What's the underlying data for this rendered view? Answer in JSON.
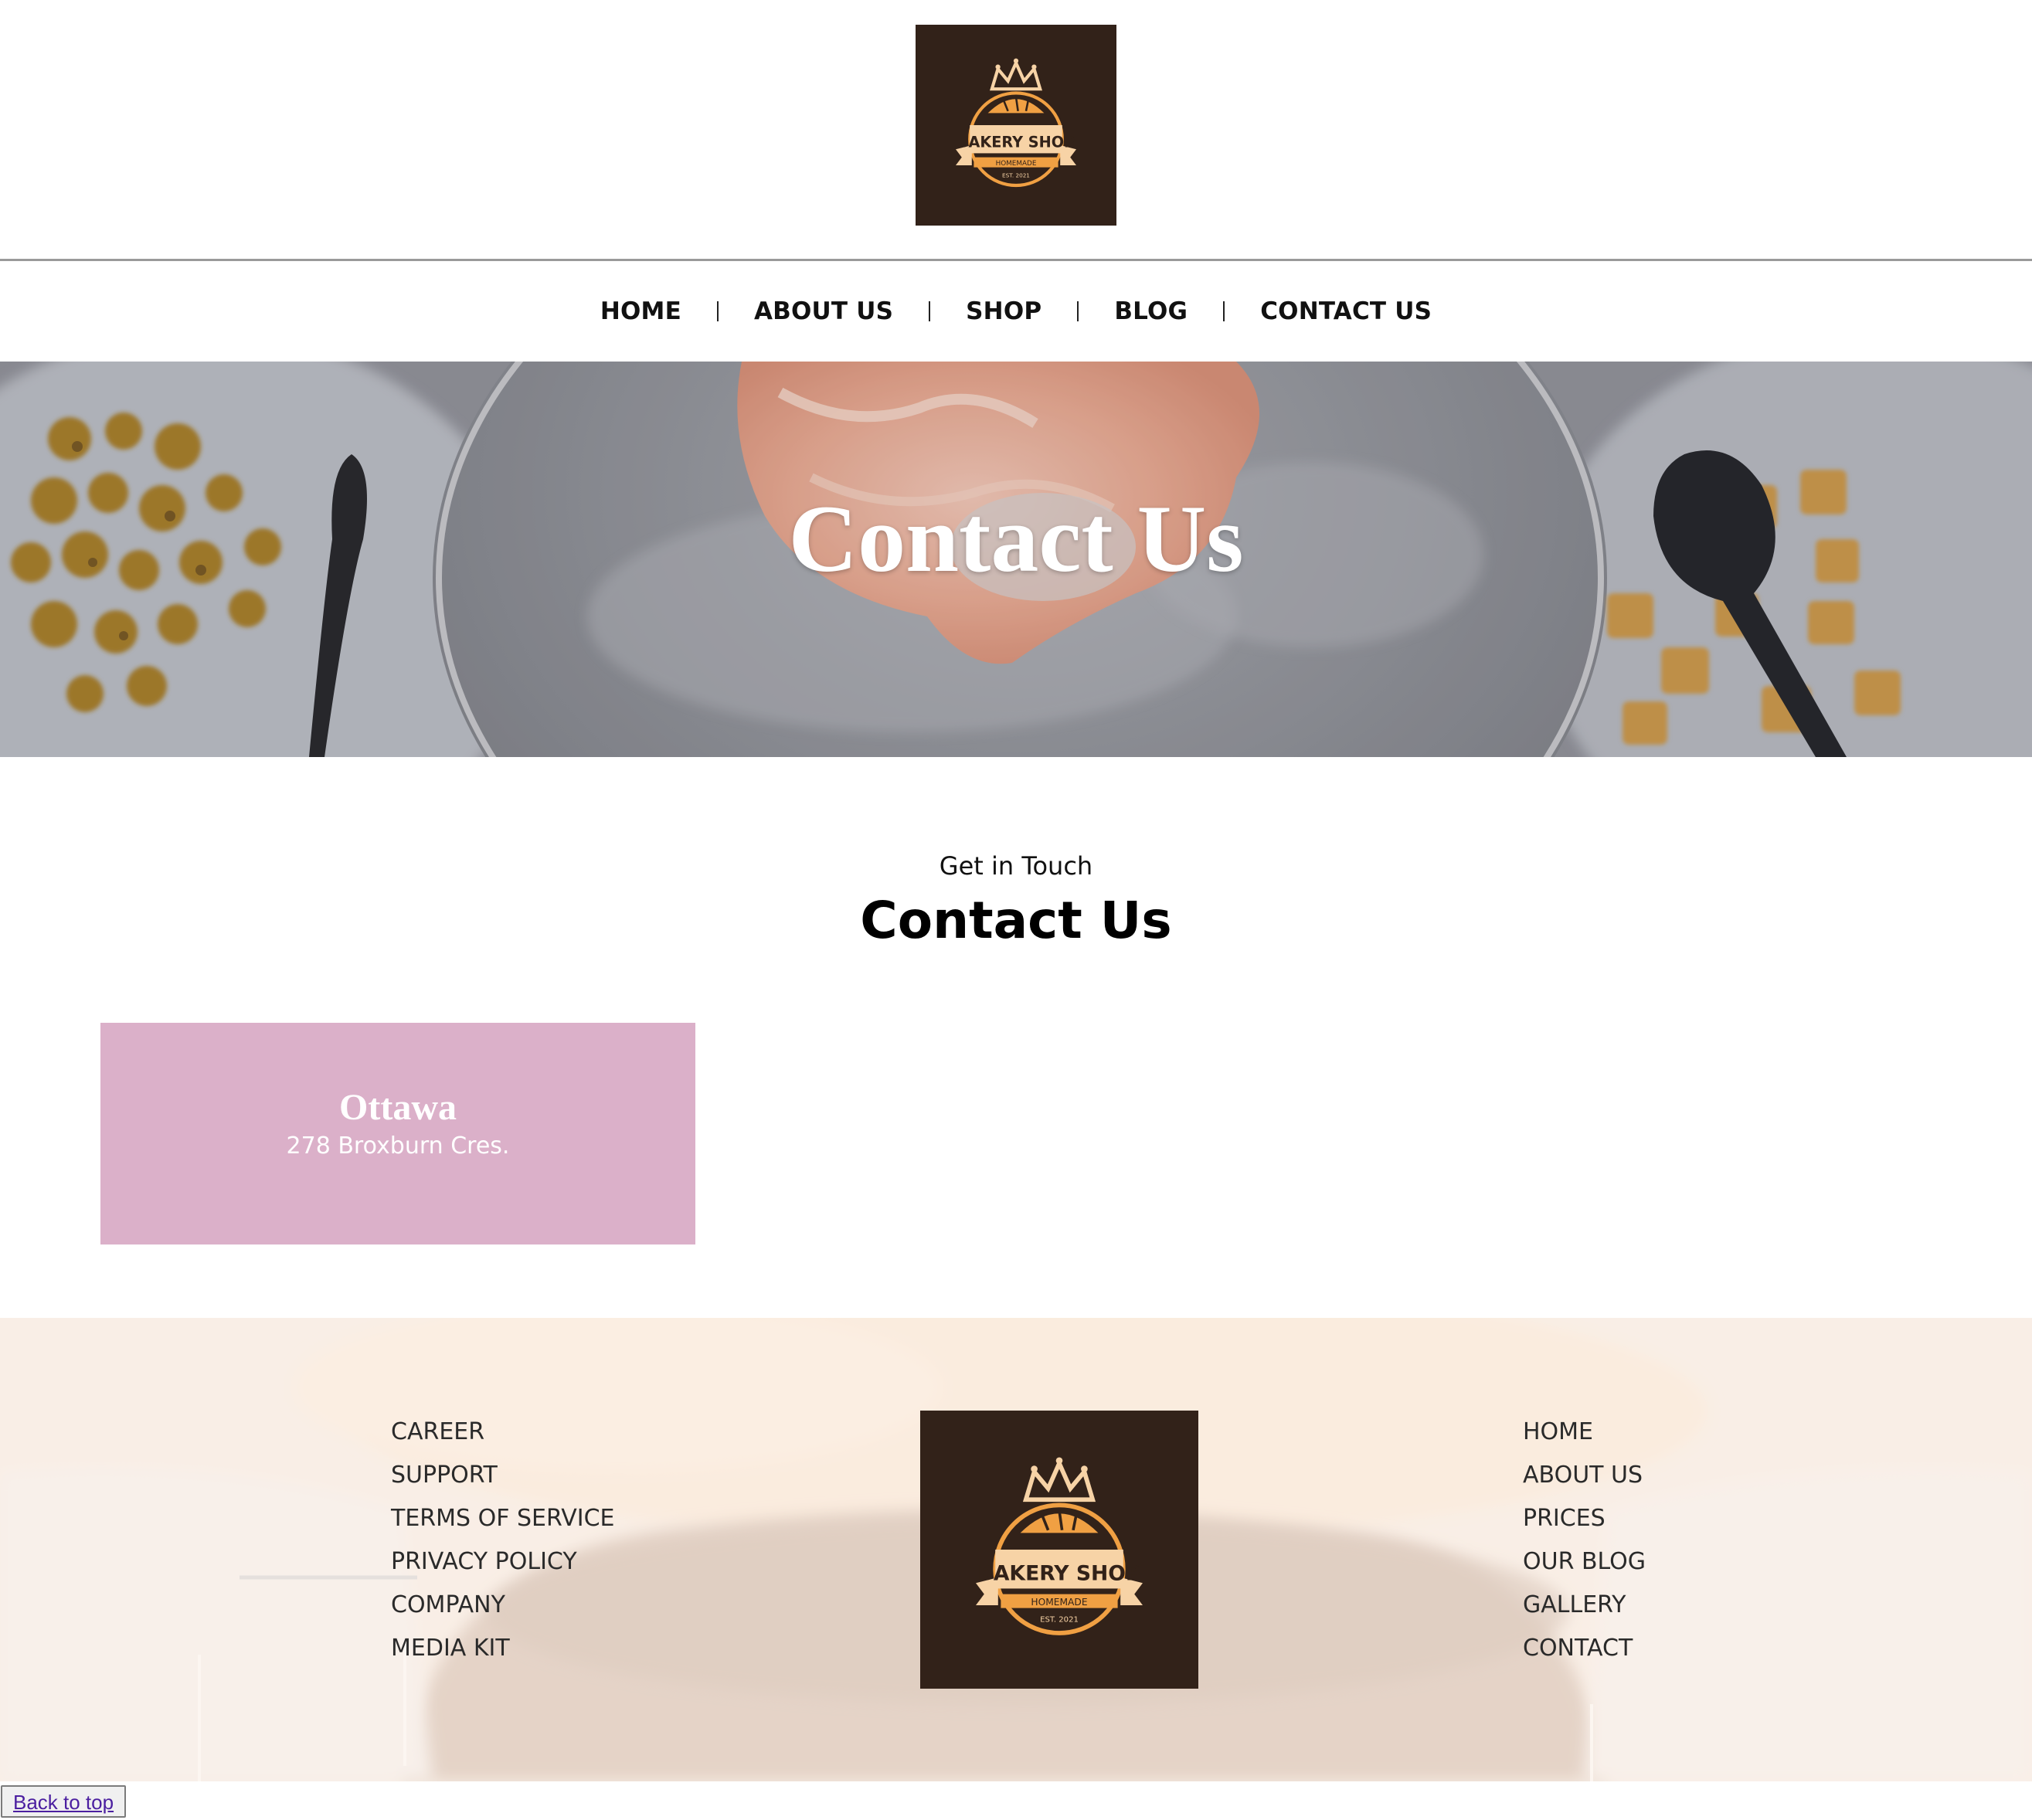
{
  "brand": {
    "logo_text": "BAKERY SHOP",
    "logo_ribbon": "HOMEMADE",
    "logo_est": "EST. 2021",
    "colors": {
      "logo_bg": "#322219",
      "logo_orange": "#f0a043",
      "logo_cream": "#f7d3a6",
      "card_pink": "#dbb0c9"
    }
  },
  "nav": {
    "items": [
      "HOME",
      "ABOUT US",
      "SHOP",
      "BLOG",
      "CONTACT US"
    ]
  },
  "hero": {
    "title": "Contact Us"
  },
  "contact": {
    "kicker": "Get in Touch",
    "title": "Contact Us",
    "location": {
      "city": "Ottawa",
      "address": "278 Broxburn Cres."
    }
  },
  "footer": {
    "left_links": [
      "CAREER",
      "SUPPORT",
      "TERMS OF SERVICE",
      "PRIVACY POLICY",
      "COMPANY",
      "MEDIA KIT"
    ],
    "right_links": [
      "HOME",
      "ABOUT US",
      "PRICES",
      "OUR BLOG",
      "GALLERY",
      "CONTACT"
    ]
  },
  "back_to_top": "Back to top"
}
